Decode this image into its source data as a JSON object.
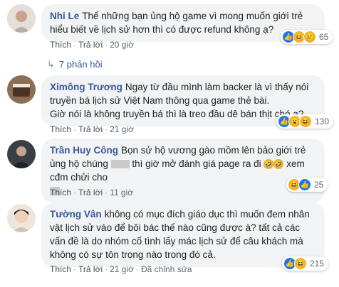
{
  "colors": {
    "link": "#385898",
    "bubble": "#f2f3f5",
    "like": "#1877f2",
    "emoji": "#f7b125"
  },
  "comments": [
    {
      "author": "Nhi Le",
      "text": "Thế những bạn ủng hộ game vì mong muốn giới trẻ hiểu biết về lịch sử hơn thì có được refund không ạ?",
      "actions": {
        "like": "Thích",
        "reply": "Trả lời",
        "time": "20 giờ"
      },
      "reactions": {
        "icons": [
          "like-icon",
          "haha-icon",
          "sad-icon"
        ],
        "count": "65"
      },
      "replies_link": "7 phản hồi"
    },
    {
      "author": "Ximông Trương",
      "text": "Ngay từ đầu mình làm backer là vì thấy nói truyền bá lịch sử Việt Nam thông qua game thẻ bài.",
      "text2": "Giờ nói là không truyền bá thì là treo đầu dê bán thịt chó ạ?",
      "actions": {
        "like": "Thích",
        "reply": "Trả lời",
        "time": "21 giờ"
      },
      "reactions": {
        "icons": [
          "like-icon",
          "wow-icon",
          "haha-icon"
        ],
        "count": "130"
      }
    },
    {
      "author": "Trần Huy Công",
      "text_a": "Bọn sử hộ vương gào mồm lên bảo giới trẻ ủng hộ chúng",
      "text_b": "thì giờ mở đánh giá page ra đi",
      "text_c": "xem cđm chửi cho",
      "actions": {
        "like": "Thích",
        "reply": "Trả lời",
        "time": "11 giờ"
      },
      "reactions": {
        "icons": [
          "haha-icon",
          "like-icon"
        ],
        "count": "25"
      }
    },
    {
      "author": "Tường Vân",
      "text": "không có mục đích giáo dục thì muốn đem nhân vật lịch sử vào để bôi bác thế nào cũng được à? tất cả các vấn đề là do nhóm cố tình lấy mác lịch sử để câu khách mà không có sự tôn trọng nào trong đó cả.",
      "actions": {
        "like": "Thích",
        "reply": "Trả lời",
        "time": "21 giờ",
        "edited": "Đã chỉnh sửa"
      },
      "reactions": {
        "icons": [
          "like-icon",
          "haha-icon"
        ],
        "count": "215"
      }
    }
  ]
}
